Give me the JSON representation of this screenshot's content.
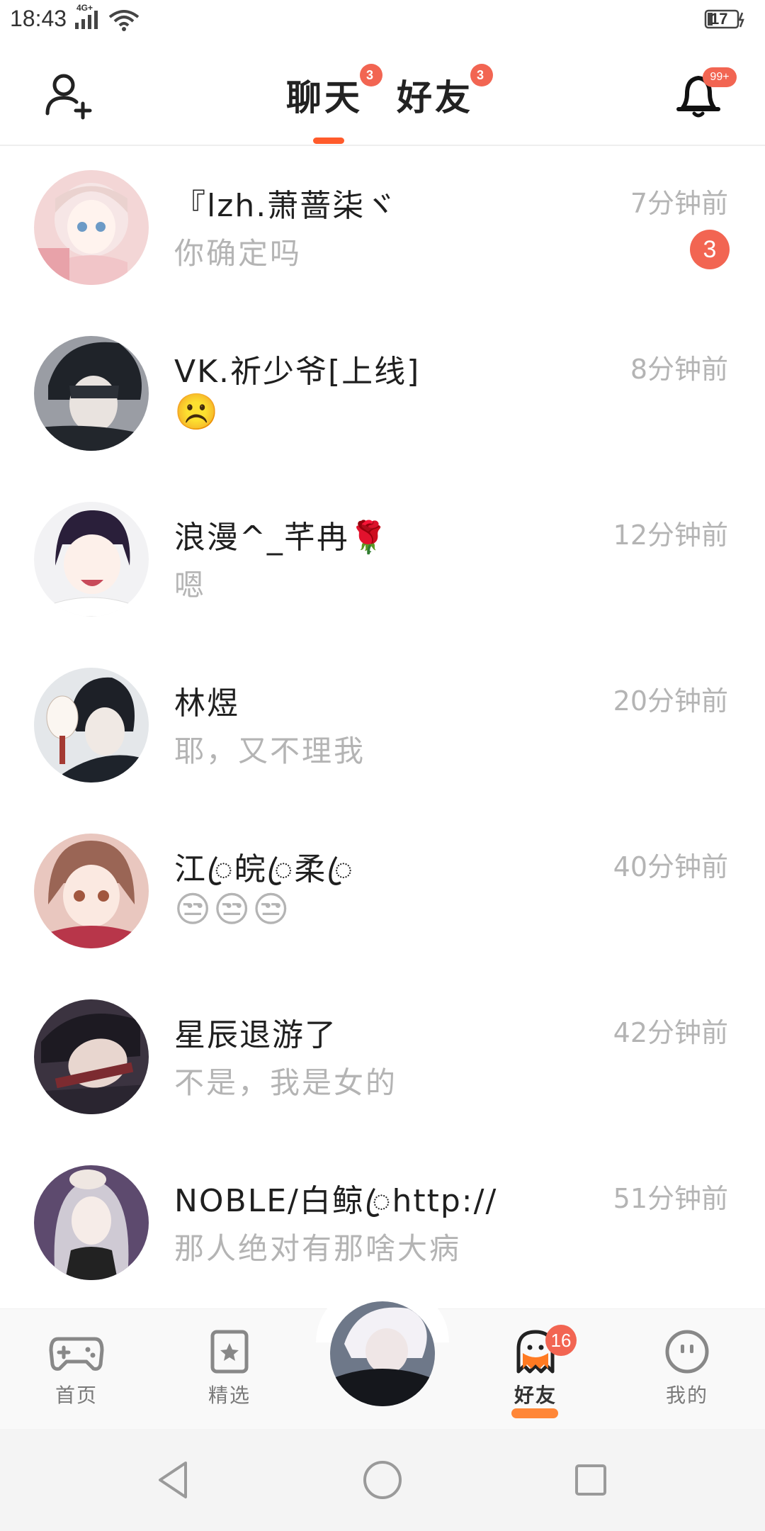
{
  "status_bar": {
    "time": "18:43",
    "network": "4G+",
    "battery": "17"
  },
  "header": {
    "tabs": [
      {
        "label": "聊天",
        "badge": "3",
        "active": true
      },
      {
        "label": "好友",
        "badge": "3",
        "active": false
      }
    ],
    "bell_badge": "99+",
    "colors": {
      "accent": "#ff5b2b",
      "badge": "#f26552"
    }
  },
  "conversations": [
    {
      "name": "『lzh.萧蔷柒ヾ",
      "message": "你确定吗",
      "time": "7分钟前",
      "unread": "3"
    },
    {
      "name": "VK.祈少爷[上线]",
      "message": "☹️",
      "time": "8分钟前"
    },
    {
      "name": "浪漫^_芊冉🌹",
      "message": "嗯",
      "time": "12分钟前"
    },
    {
      "name": "林煜",
      "message": "耶，又不理我",
      "time": "20分钟前"
    },
    {
      "name": "江ꦿ皖ꦿ柔ꦿ",
      "message": "😒😒😒",
      "time": "40分钟前"
    },
    {
      "name": "星辰退游了",
      "message": "不是，我是女的",
      "time": "42分钟前"
    },
    {
      "name": "NOBLE/白鲸ꦿhttp://",
      "message": "那人绝对有那啥大病",
      "time": "51分钟前"
    }
  ],
  "bottom_nav": {
    "items": [
      {
        "label": "首页",
        "icon": "gamepad-icon"
      },
      {
        "label": "精选",
        "icon": "star-card-icon"
      },
      {
        "label": "好友",
        "icon": "ghost-icon",
        "badge": "16",
        "active": true
      },
      {
        "label": "我的",
        "icon": "smiley-icon"
      }
    ]
  },
  "system_nav": {
    "icons": [
      "back-triangle-icon",
      "home-circle-icon",
      "recents-square-icon"
    ]
  }
}
